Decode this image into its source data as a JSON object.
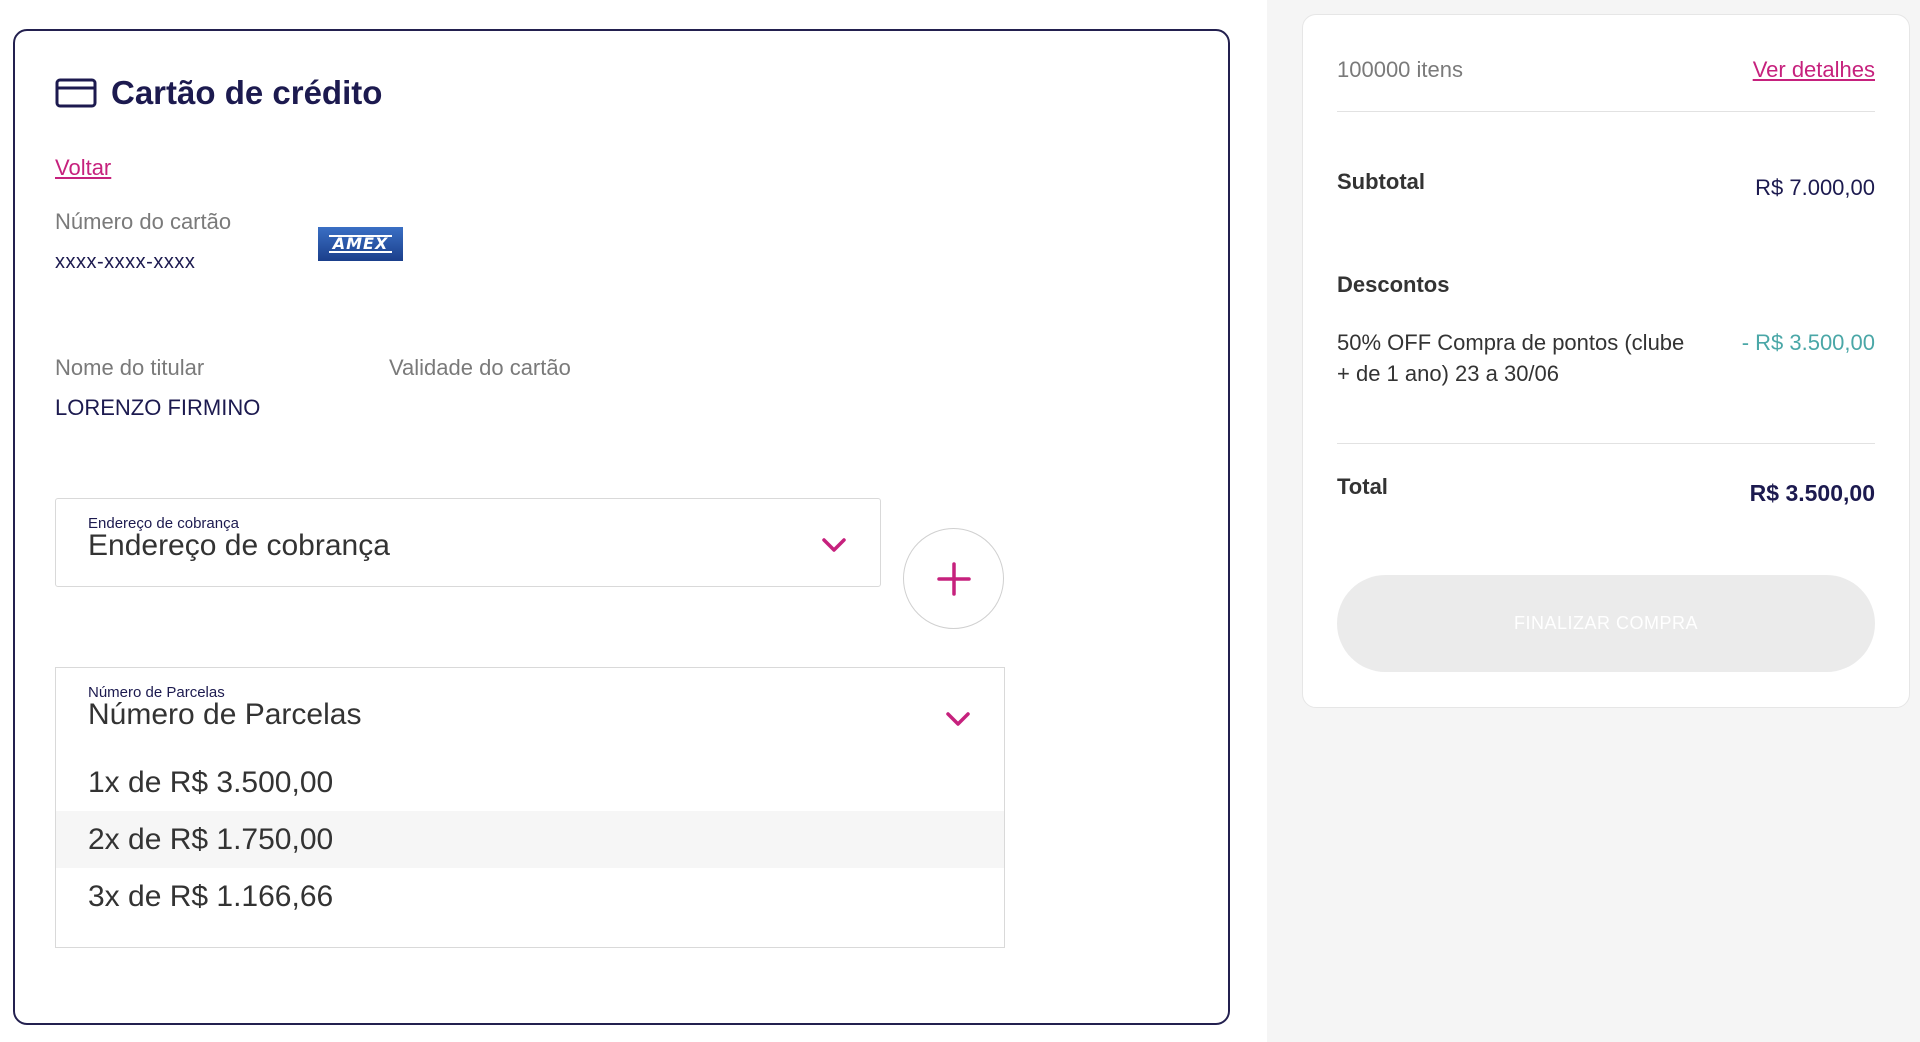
{
  "payment": {
    "title": "Cartão de crédito",
    "back_label": "Voltar",
    "card_number_label": "Número do cartão",
    "card_number_value": "xxxx-xxxx-xxxx",
    "brand": "AMEX",
    "holder_label": "Nome do titular",
    "holder_value": "LORENZO FIRMINO",
    "expiry_label": "Validade do cartão",
    "expiry_value": "",
    "billing": {
      "float_label": "Endereço de cobrança",
      "placeholder": "Endereço de cobrança"
    },
    "installments": {
      "float_label": "Número de Parcelas",
      "placeholder": "Número de Parcelas",
      "options": [
        "1x de R$ 3.500,00",
        "2x de R$ 1.750,00",
        "3x de R$ 1.166,66"
      ],
      "highlighted_index": 1
    }
  },
  "summary": {
    "items_count": "100000 itens",
    "details_link": "Ver detalhes",
    "subtotal_label": "Subtotal",
    "subtotal_value": "R$ 7.000,00",
    "discounts_label": "Descontos",
    "discount_desc": "50% OFF Compra de pontos (clube + de 1 ano) 23 a 30/06",
    "discount_value": "- R$ 3.500,00",
    "total_label": "Total",
    "total_value": "R$ 3.500,00",
    "finalize_label": "FINALIZAR COMPRA"
  },
  "colors": {
    "primary_dark": "#1c1a4f",
    "accent_magenta": "#c6217d",
    "discount_teal": "#4aa7a7",
    "disabled_button": "#ebebeb"
  },
  "icons": [
    "credit-card-icon",
    "chevron-down-icon",
    "plus-icon",
    "amex-logo"
  ]
}
